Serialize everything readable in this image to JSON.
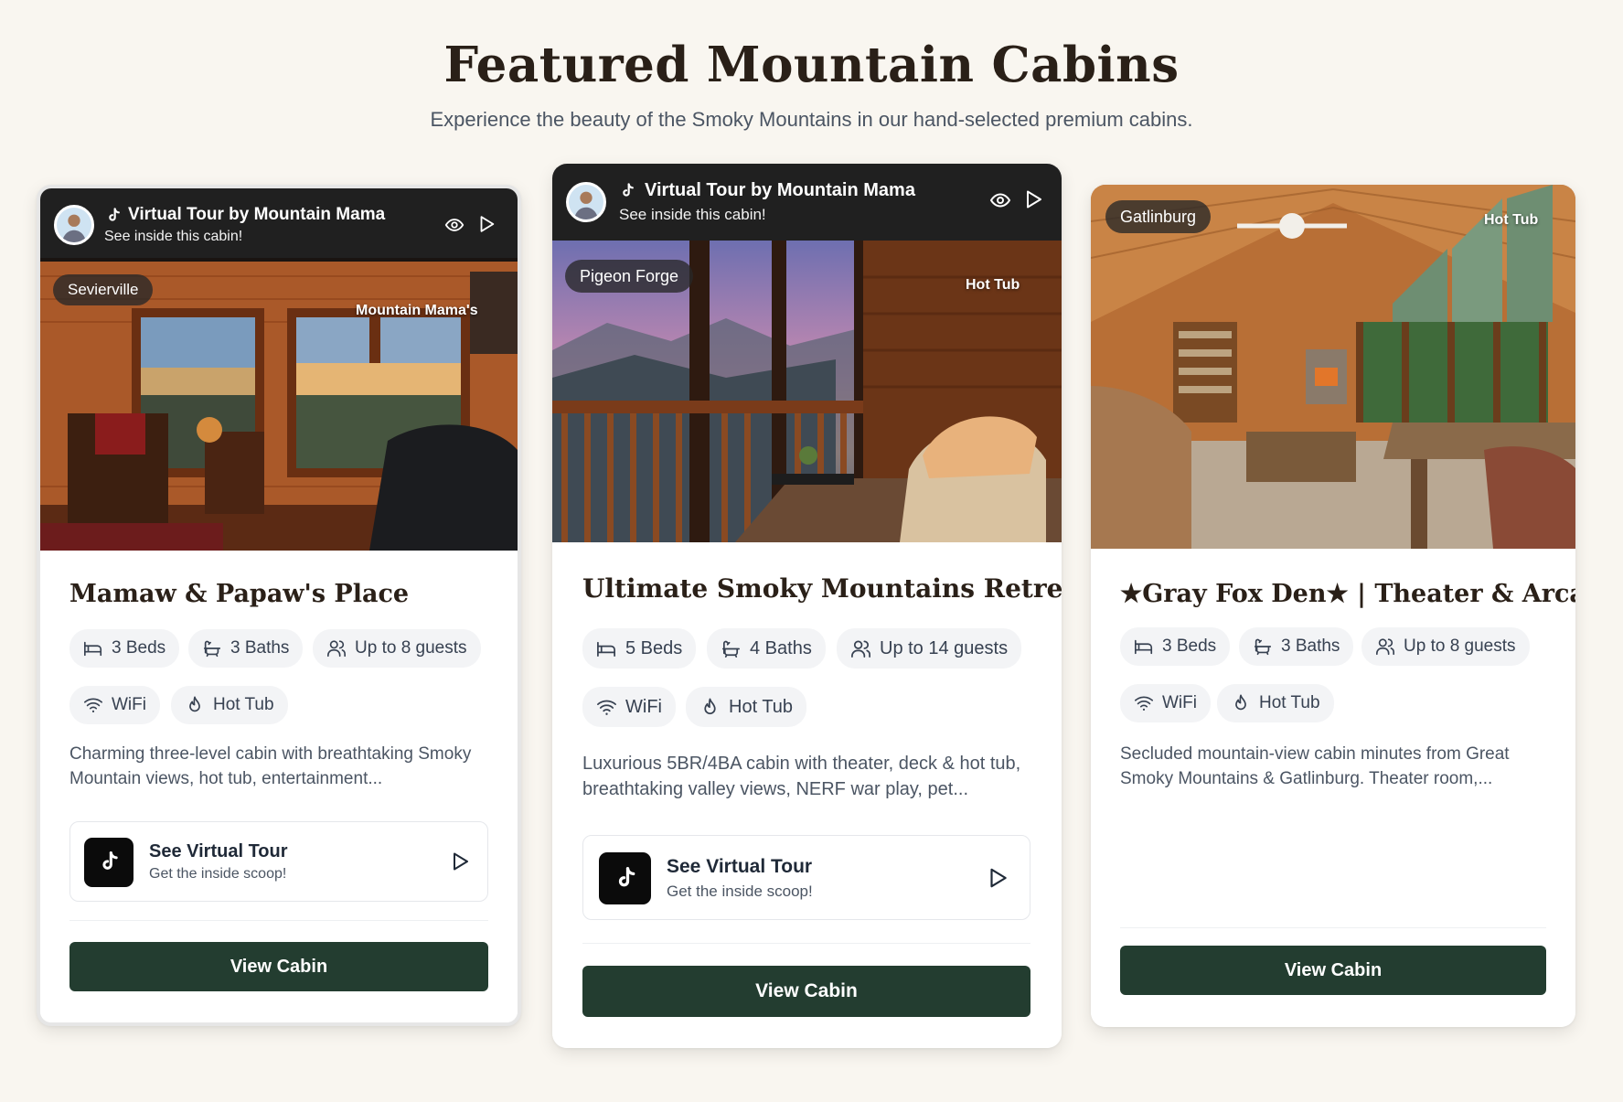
{
  "header": {
    "title": "Featured Mountain Cabins",
    "subtitle": "Experience the beauty of the Smoky Mountains in our hand-selected premium cabins."
  },
  "cards": [
    {
      "tour_title": "Virtual Tour by Mountain Mama",
      "tour_sub": "See inside this cabin!",
      "location": "Sevierville",
      "overlay": "Mountain Mama's",
      "title": "Mamaw & Papaw's Place",
      "beds": "3 Beds",
      "baths": "3 Baths",
      "guests": "Up to 8 guests",
      "amenity1": "WiFi",
      "amenity2": "Hot Tub",
      "description": "Charming three-level cabin with breathtaking Smoky Mountain views, hot tub, entertainment...",
      "vt_title": "See Virtual Tour",
      "vt_sub": "Get the inside scoop!",
      "button": "View Cabin"
    },
    {
      "tour_title": "Virtual Tour by Mountain Mama",
      "tour_sub": "See inside this cabin!",
      "location": "Pigeon Forge",
      "overlay": "Hot Tub",
      "title": "Ultimate Smoky Mountains Retreat",
      "beds": "5 Beds",
      "baths": "4 Baths",
      "guests": "Up to 14 guests",
      "amenity1": "WiFi",
      "amenity2": "Hot Tub",
      "description": "Luxurious 5BR/4BA cabin with theater, deck & hot tub, breathtaking valley views, NERF war play, pet...",
      "vt_title": "See Virtual Tour",
      "vt_sub": "Get the inside scoop!",
      "button": "View Cabin"
    },
    {
      "location": "Gatlinburg",
      "overlay": "Hot Tub",
      "title": "★Gray Fox Den★ | Theater & Arcad...",
      "beds": "3 Beds",
      "baths": "3 Baths",
      "guests": "Up to 8 guests",
      "amenity1": "WiFi",
      "amenity2": "Hot Tub",
      "description": "Secluded mountain-view cabin minutes from Great Smoky Mountains & Gatlinburg. Theater room,...",
      "button": "View Cabin"
    }
  ],
  "icons": {
    "tiktok": "tiktok-icon",
    "eye": "eye-icon",
    "play": "play-icon",
    "bed": "bed-icon",
    "bath": "bath-icon",
    "users": "users-icon",
    "wifi": "wifi-icon",
    "flame": "flame-icon"
  },
  "colors": {
    "background": "#f9f6f0",
    "button": "#233d30",
    "title": "#2a2018",
    "pill": "#f3f4f6"
  }
}
